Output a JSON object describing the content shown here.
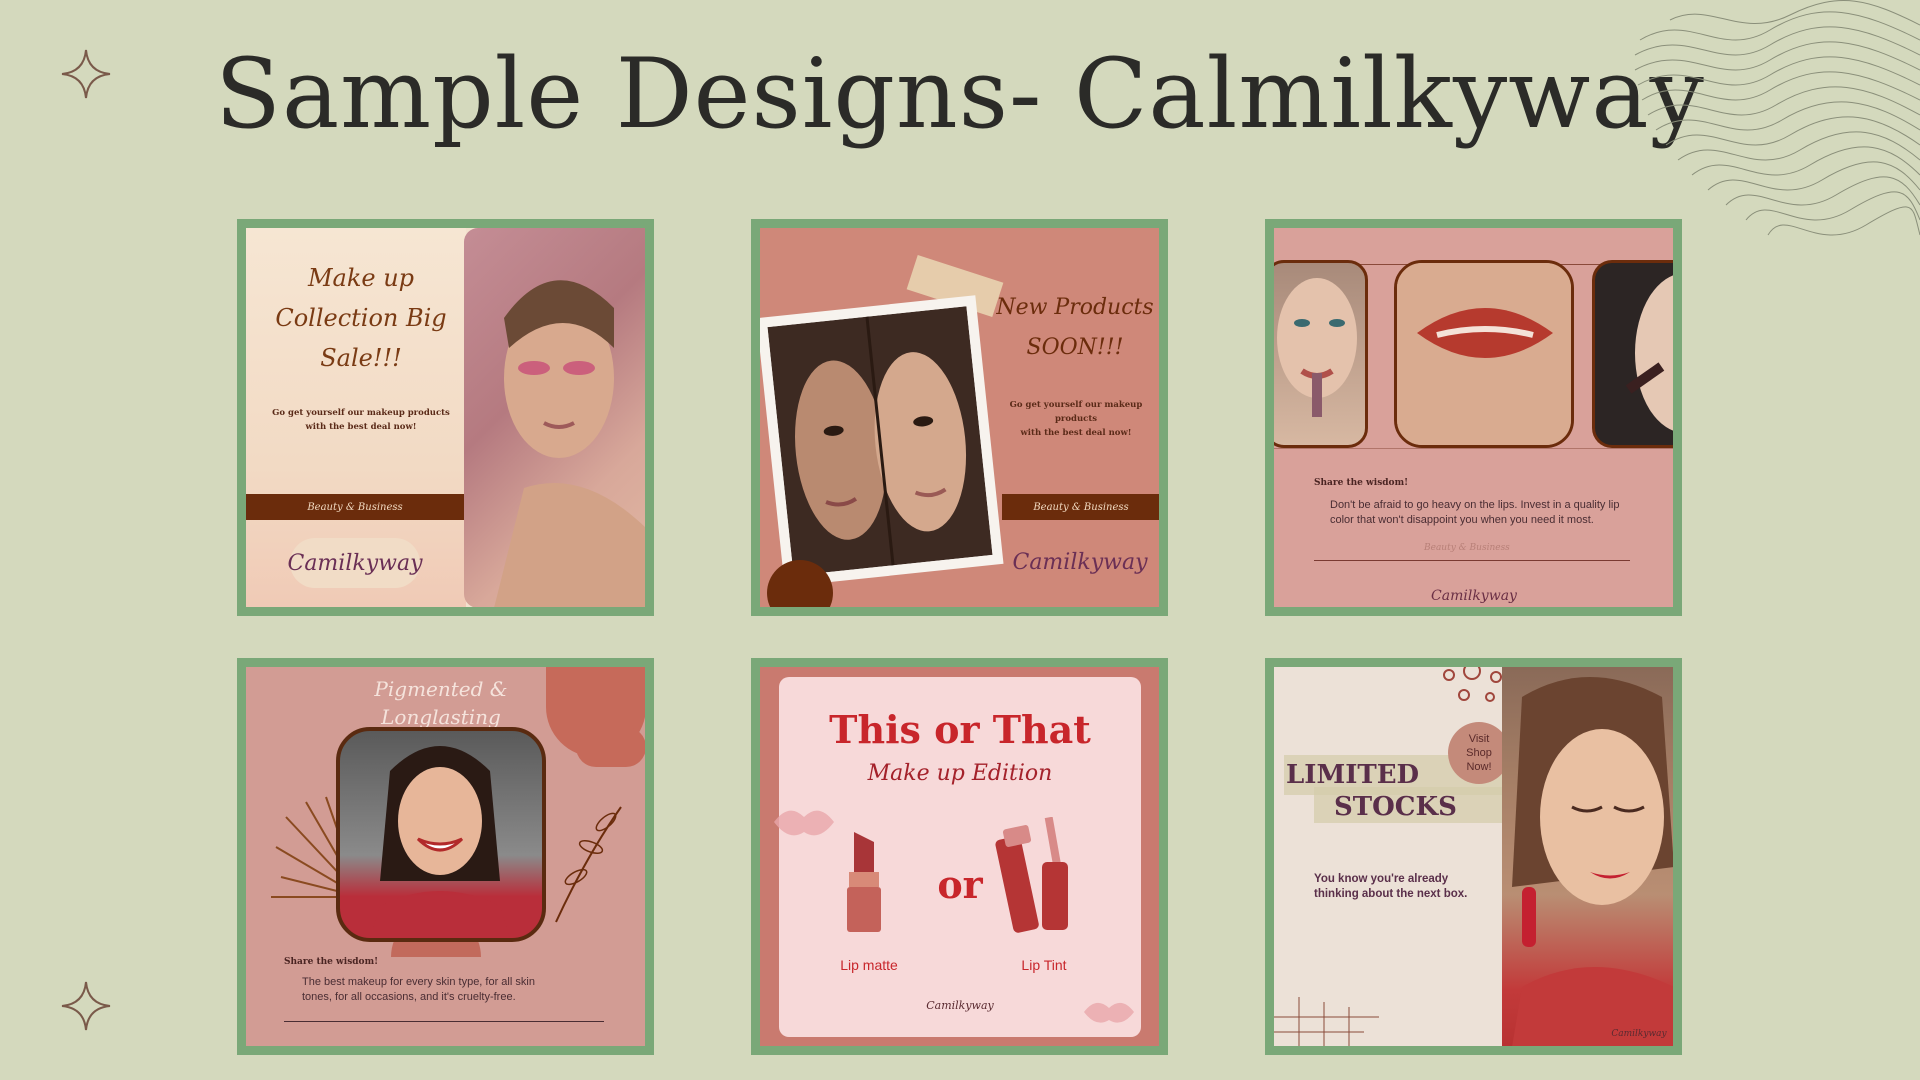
{
  "page": {
    "title": "Sample Designs- Calmilkyway"
  },
  "decor": {
    "sparkle_icon": "sparkle-icon",
    "waves_icon": "wavy-lines-graphic"
  },
  "cards": {
    "c1": {
      "headline": [
        "Make up",
        "Collection Big",
        "Sale!!!"
      ],
      "subtext": [
        "Go get yourself our makeup products",
        "with the best deal now!"
      ],
      "bar_text": "Beauty & Business",
      "logo": "Camilkyway"
    },
    "c2": {
      "headline": [
        "New Products",
        "SOON!!!"
      ],
      "subtext": [
        "Go get yourself our makeup products",
        "with the best deal now!"
      ],
      "bar_text": "Beauty & Business",
      "logo": "Camilkyway"
    },
    "c3": {
      "heading": "Share the wisdom!",
      "body": "Don't be afraid to go heavy on the lips. Invest in a quality lip color that won't disappoint you when you need it most.",
      "faint": "Beauty & Business",
      "logo": "Camilkyway"
    },
    "c4": {
      "headline": [
        "Pigmented &",
        "Longlasting"
      ],
      "heading": "Share the wisdom!",
      "body": "The best makeup for every skin type, for all skin tones, for all occasions, and it's cruelty-free."
    },
    "c5": {
      "title": "This or That",
      "subtitle": "Make up Edition",
      "or": "or",
      "left_label": "Lip matte",
      "right_label": "Lip Tint",
      "logo": "Camilkyway"
    },
    "c6": {
      "headline": [
        "LIMITED",
        "STOCKS"
      ],
      "badge": [
        "Visit",
        "Shop",
        "Now!"
      ],
      "body": "You know you're already thinking about the next box.",
      "logo": "Camilkyway"
    }
  },
  "colors": {
    "background": "#d4d9bd",
    "frame": "#7aa878",
    "accent_brown": "#6b2c0c",
    "red": "#c8262b"
  }
}
